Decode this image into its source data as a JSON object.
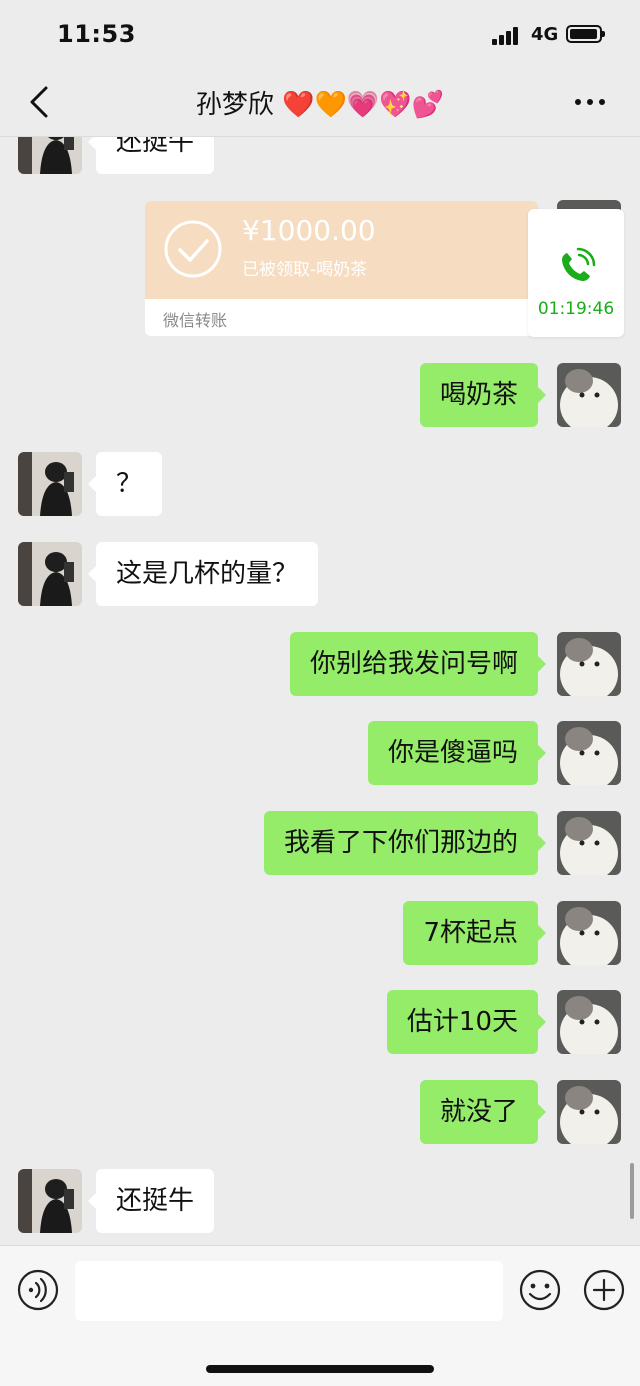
{
  "status_bar": {
    "time": "11:53",
    "network": "4G"
  },
  "header": {
    "title": "孙梦欣 ❤️🧡💗💖💕"
  },
  "messages": [
    {
      "side": "in",
      "text": "还挺牛"
    },
    {
      "side": "out",
      "text": "喝奶茶"
    },
    {
      "side": "in",
      "text": "？"
    },
    {
      "side": "in",
      "text": "这是几杯的量？"
    },
    {
      "side": "out",
      "text": "你别给我发问号啊"
    },
    {
      "side": "out",
      "text": "你是傻逼吗"
    },
    {
      "side": "out",
      "text": "我看了下你们那边的"
    },
    {
      "side": "out",
      "text": "7杯起点"
    },
    {
      "side": "out",
      "text": "估计10天"
    },
    {
      "side": "out",
      "text": "就没了"
    },
    {
      "side": "in",
      "text": "还挺牛"
    }
  ],
  "transfer": {
    "amount": "¥1000.00",
    "status": "已被领取-喝奶茶",
    "label": "微信转账"
  },
  "call": {
    "duration": "01:19:46"
  },
  "colors": {
    "background": "#ececec",
    "bubble_out": "#95ec69",
    "bubble_in": "#ffffff",
    "transfer": "#f6dcc0",
    "call_green": "#1aad19"
  },
  "icons": {
    "back": "chevron-left-icon",
    "more": "more-dots-icon",
    "voice": "voice-icon",
    "emoji": "emoji-icon",
    "plus": "plus-icon",
    "call": "phone-icon",
    "check": "check-circle-icon"
  }
}
